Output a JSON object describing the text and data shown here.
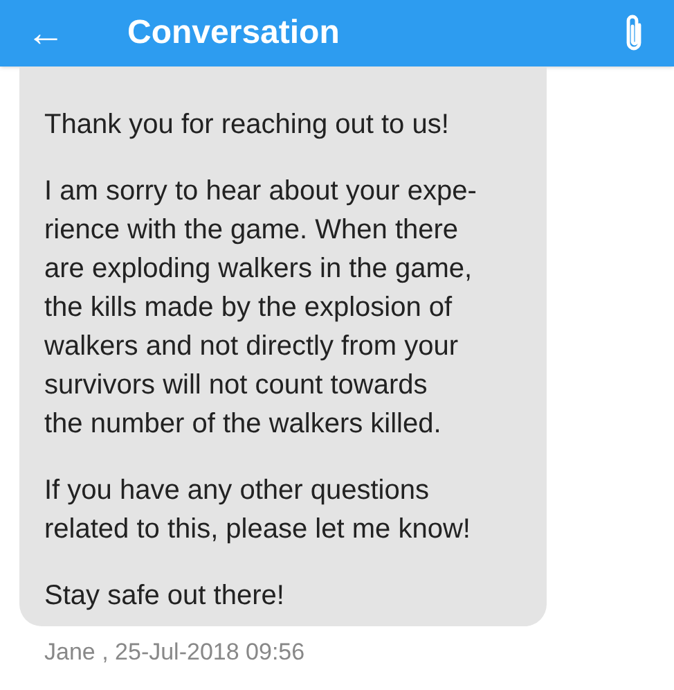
{
  "header": {
    "back": "←",
    "title": "Conversation"
  },
  "message": {
    "paragraphs": [
      "Thank you for reaching out to us!",
      "I am sorry to hear about your expe-\nrience with the game. When there\nare exploding walkers in the game,\nthe kills made by the explosion of\nwalkers and not directly from your\nsurvivors will not count towards\nthe number of the walkers killed.",
      "If you have any other questions\nrelated to this, please let me know!",
      "Stay safe out there!"
    ],
    "meta": "Jane , 25-Jul-2018 09:56"
  }
}
